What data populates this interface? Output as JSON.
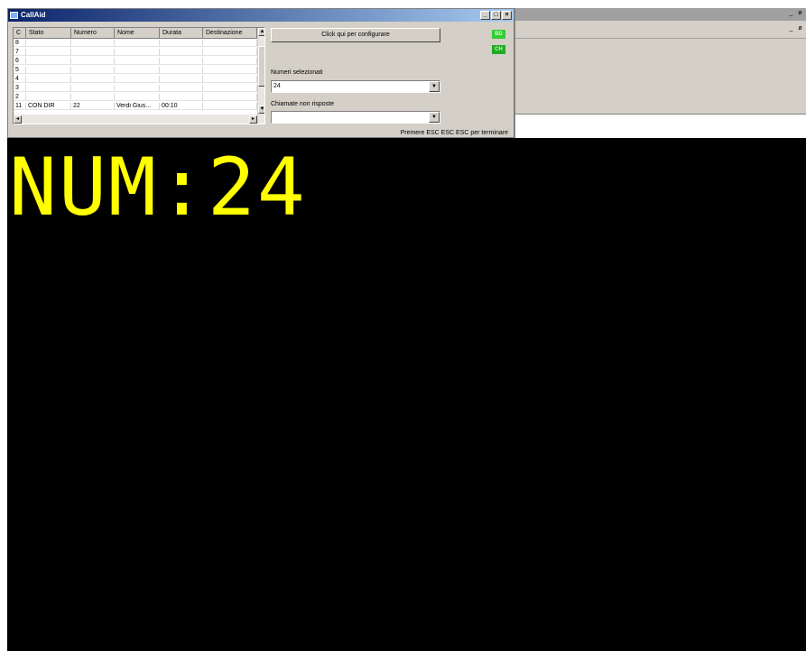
{
  "callaid": {
    "title": "CallAid",
    "min_label": "_",
    "max_label": "□",
    "close_label": "×",
    "grid": {
      "columns": [
        "C",
        "Stato",
        "Numero",
        "Nome",
        "Durata",
        "Destinazione"
      ],
      "rows": [
        {
          "c": "8",
          "stato": "",
          "numero": "",
          "nome": "",
          "durata": "",
          "dest": ""
        },
        {
          "c": "7",
          "stato": "",
          "numero": "",
          "nome": "",
          "durata": "",
          "dest": ""
        },
        {
          "c": "6",
          "stato": "",
          "numero": "",
          "nome": "",
          "durata": "",
          "dest": ""
        },
        {
          "c": "5",
          "stato": "",
          "numero": "",
          "nome": "",
          "durata": "",
          "dest": ""
        },
        {
          "c": "4",
          "stato": "",
          "numero": "",
          "nome": "",
          "durata": "",
          "dest": ""
        },
        {
          "c": "3",
          "stato": "",
          "numero": "",
          "nome": "",
          "durata": "",
          "dest": ""
        },
        {
          "c": "2",
          "stato": "",
          "numero": "",
          "nome": "",
          "durata": "",
          "dest": ""
        },
        {
          "c": "11",
          "stato": "CON DIR",
          "numero": "22",
          "nome": "Verdi Gius...",
          "durata": "00:10",
          "dest": ""
        }
      ]
    },
    "configure_button": "Click qui per configurare",
    "led_top": "BD",
    "led_bottom": "CH",
    "numeri_label": "Numeri selezionati",
    "numeri_value": "24",
    "chiamate_label": "Chiamate non risposte",
    "chiamate_value": "",
    "status_text": "Premere ESC ESC ESC per terminare",
    "colors": {
      "led": "#33cc33",
      "titlebar_start": "#0a246a",
      "titlebar_end": "#a6caf0"
    }
  },
  "right_window": {
    "min_label": "_",
    "restore_label": "ø"
  },
  "display": {
    "text": "NUM:24",
    "color": "#ffff00",
    "background": "#000000"
  }
}
